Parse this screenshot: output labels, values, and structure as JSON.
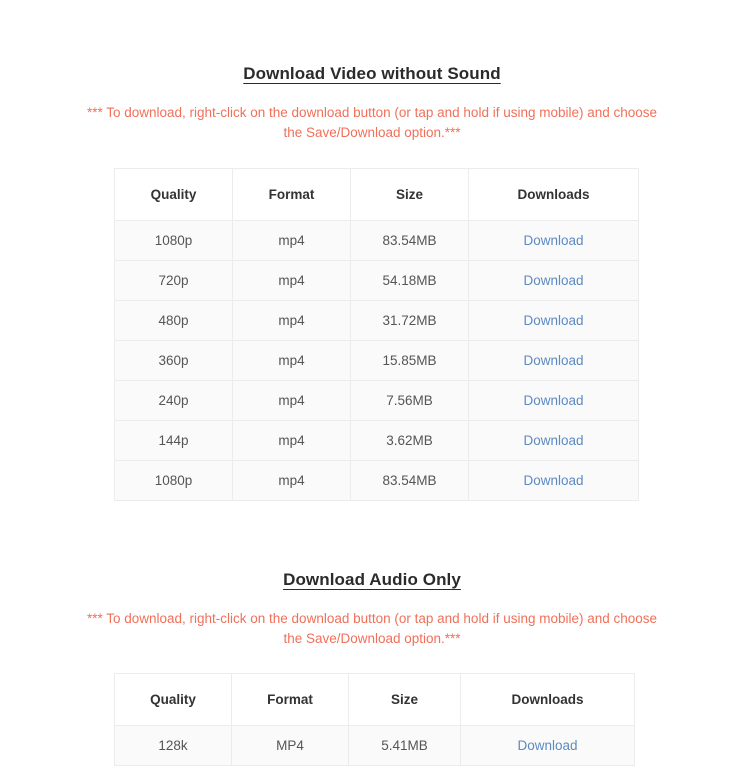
{
  "video_section": {
    "heading": "Download Video without Sound",
    "notice": "*** To download, right-click on the download button (or tap and hold if using mobile) and choose the Save/Download option.***",
    "columns": [
      "Quality",
      "Format",
      "Size",
      "Downloads"
    ],
    "rows": [
      {
        "quality": "1080p",
        "format": "mp4",
        "size": "83.54MB",
        "download": "Download"
      },
      {
        "quality": "720p",
        "format": "mp4",
        "size": "54.18MB",
        "download": "Download"
      },
      {
        "quality": "480p",
        "format": "mp4",
        "size": "31.72MB",
        "download": "Download"
      },
      {
        "quality": "360p",
        "format": "mp4",
        "size": "15.85MB",
        "download": "Download"
      },
      {
        "quality": "240p",
        "format": "mp4",
        "size": "7.56MB",
        "download": "Download"
      },
      {
        "quality": "144p",
        "format": "mp4",
        "size": "3.62MB",
        "download": "Download"
      },
      {
        "quality": "1080p",
        "format": "mp4",
        "size": "83.54MB",
        "download": "Download"
      }
    ]
  },
  "audio_section": {
    "heading": "Download Audio Only",
    "notice": "*** To download, right-click on the download button (or tap and hold if using mobile) and choose the Save/Download option.***",
    "columns": [
      "Quality",
      "Format",
      "Size",
      "Downloads"
    ],
    "rows": [
      {
        "quality": "128k",
        "format": "MP4",
        "size": "5.41MB",
        "download": "Download"
      }
    ]
  },
  "colors": {
    "notice_text": "#f0705a",
    "heading_text": "#2b2b2b",
    "link": "#5b8ac4",
    "row_background": "#fafafa",
    "border": "#ececec"
  }
}
